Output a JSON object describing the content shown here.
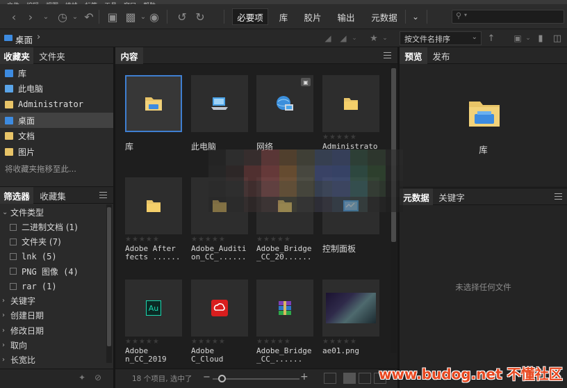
{
  "menu": {
    "items": [
      "文件",
      "编辑",
      "视图",
      "堆栈",
      "标签",
      "工具",
      "窗口",
      "帮助"
    ]
  },
  "toolbar": {
    "workspaces": [
      {
        "label": "必要项",
        "active": true
      },
      {
        "label": "库",
        "active": false
      },
      {
        "label": "胶片",
        "active": false
      },
      {
        "label": "输出",
        "active": false
      },
      {
        "label": "元数据",
        "active": false
      }
    ],
    "more_icon": "chevron-down-icon",
    "search_icon": "search-icon"
  },
  "pathbar": {
    "current": "桌面",
    "sort_label": "按文件名排序"
  },
  "left_top": {
    "tabs": [
      {
        "label": "收藏夹",
        "active": true
      },
      {
        "label": "文件夹",
        "active": false
      }
    ],
    "items": [
      {
        "label": "库",
        "color": "#3d8be0",
        "selected": false
      },
      {
        "label": "此电脑",
        "color": "#5aa4e8",
        "selected": false
      },
      {
        "label": "Administrator",
        "color": "#e8c468",
        "selected": false
      },
      {
        "label": "桌面",
        "color": "#3d8be0",
        "selected": true
      },
      {
        "label": "文档",
        "color": "#e8c468",
        "selected": false
      },
      {
        "label": "图片",
        "color": "#e8c468",
        "selected": false
      }
    ],
    "hint": "将收藏夹拖移至此..."
  },
  "left_bottom": {
    "tabs": [
      {
        "label": "筛选器",
        "active": true
      },
      {
        "label": "收藏集",
        "active": false
      }
    ],
    "rows": [
      {
        "label": "文件类型",
        "kind": "group-open"
      },
      {
        "label": "二进制文档 (1)",
        "kind": "check"
      },
      {
        "label": "文件夹 (7)",
        "kind": "check"
      },
      {
        "label": "lnk (5)",
        "kind": "check"
      },
      {
        "label": "PNG 图像 (4)",
        "kind": "check"
      },
      {
        "label": "rar (1)",
        "kind": "check"
      },
      {
        "label": "关键字",
        "kind": "group"
      },
      {
        "label": "创建日期",
        "kind": "group"
      },
      {
        "label": "修改日期",
        "kind": "group"
      },
      {
        "label": "取向",
        "kind": "group"
      },
      {
        "label": "长宽比",
        "kind": "group"
      }
    ]
  },
  "content": {
    "title": "内容",
    "tiles": [
      {
        "label": "库",
        "type": "library",
        "stars": false
      },
      {
        "label": "此电脑",
        "type": "computer",
        "stars": false
      },
      {
        "label": "网络",
        "type": "network",
        "stars": false
      },
      {
        "label": "Administrato",
        "type": "folder",
        "stars": true
      },
      {
        "label": "Adobe After\nfects ......",
        "type": "folder",
        "stars": true
      },
      {
        "label": "Adobe_Auditi\non_CC_......",
        "type": "folder",
        "stars": true
      },
      {
        "label": "Adobe_Bridge\n_CC_20......",
        "type": "folder",
        "stars": true
      },
      {
        "label": "控制面板",
        "type": "control",
        "stars": false
      },
      {
        "label": "Adobe\nn_CC_2019",
        "type": "audition",
        "stars": true
      },
      {
        "label": "Adobe\nC_Cloud",
        "type": "cc",
        "stars": true
      },
      {
        "label": "Adobe_Bridge\n_CC_......",
        "type": "rar",
        "stars": true
      },
      {
        "label": "ae01.png",
        "type": "image",
        "stars": true
      }
    ],
    "status": "18 个项目, 选中了",
    "audition_badge": "Au",
    "star_glyphs": "★★★★★"
  },
  "preview": {
    "tabs": [
      {
        "label": "预览",
        "active": true
      },
      {
        "label": "发布",
        "active": false
      }
    ],
    "item_label": "库"
  },
  "metadata": {
    "tabs": [
      {
        "label": "元数据",
        "active": true
      },
      {
        "label": "关键字",
        "active": false
      }
    ],
    "empty": "未选择任何文件"
  },
  "watermark": "www.budog.net 不懂社区",
  "colors": {
    "accent": "#3f7fd1",
    "folder": "#e8c468",
    "watermark": "#e84820"
  }
}
